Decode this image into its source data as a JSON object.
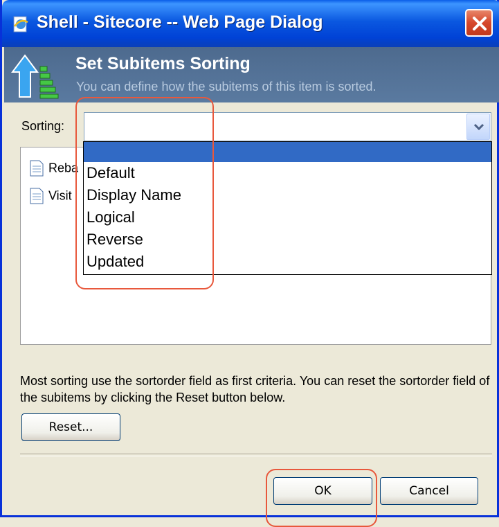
{
  "window": {
    "title": "Shell - Sitecore -- Web Page Dialog"
  },
  "header": {
    "title": "Set Subitems Sorting",
    "subtitle": "You can define how the subitems of this item is sorted."
  },
  "sorting": {
    "label": "Sorting:",
    "selected": ""
  },
  "list": {
    "items": [
      {
        "label": "Reba"
      },
      {
        "label": "Visit"
      }
    ]
  },
  "dropdown": {
    "options": [
      "",
      "Default",
      "Display Name",
      "Logical",
      "Reverse",
      "Updated"
    ]
  },
  "note": "Most sorting use the sortorder field as first criteria. You can reset the sortorder field of the subitems by clicking the Reset button below.",
  "buttons": {
    "reset": "Reset...",
    "ok": "OK",
    "cancel": "Cancel"
  },
  "colors": {
    "titlebar": "#0b58e0",
    "header": "#5a7aa0",
    "selection": "#316ac5",
    "highlight_annotation": "#e8583c"
  }
}
